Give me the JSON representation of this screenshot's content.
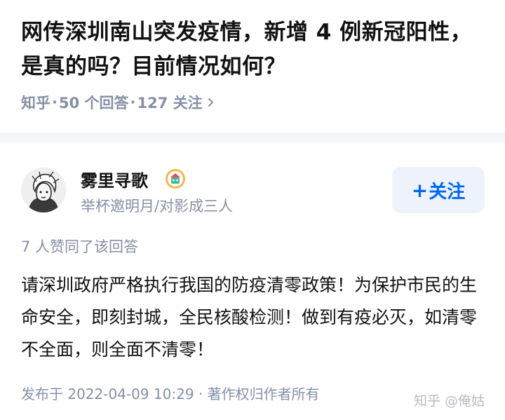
{
  "question": {
    "title": "网传深圳南山突发疫情，新增 4 例新冠阳性，是真的吗？目前情况如何？",
    "source": "知乎",
    "answers_count_label": "50 个回答",
    "followers_count_label": "127 关注",
    "separator": "·"
  },
  "answer": {
    "author": {
      "name": "雾里寻歌",
      "bio": "举杯邀明月/对影成三人"
    },
    "follow_button": {
      "plus": "+",
      "label": "关注"
    },
    "agree_text": "7 人赞同了该回答",
    "content": "请深圳政府严格执行我国的防疫清零政策！为保护市民的生命安全，即刻封城，全民核酸检测！做到有疫必灭，如清零不全面，则全面不清零！",
    "publish_info": "发布于 2022-04-09 10:29 · 著作权归作者所有"
  },
  "watermark": "知乎 @俺姑",
  "colors": {
    "accent": "#0066ff",
    "meta_text": "#8590a6",
    "divider": "#f4f5f7",
    "follow_bg": "#eef3fb"
  },
  "icons": [
    "chevron-right-icon",
    "user-badge-icon",
    "avatar"
  ]
}
